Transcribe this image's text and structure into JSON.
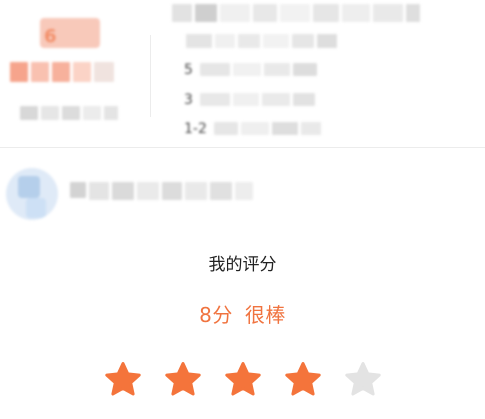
{
  "summary": {
    "hero_value": "6",
    "info_lines": [
      {
        "prefix": "5"
      },
      {
        "prefix": "3"
      },
      {
        "prefix": "1-2"
      }
    ]
  },
  "rating": {
    "title": "我的评分",
    "score": "8分",
    "verdict": "很棒",
    "stars_total": 5,
    "stars_filled": 4,
    "filled_color": "#f4743b",
    "empty_color": "#e3e3e3"
  }
}
